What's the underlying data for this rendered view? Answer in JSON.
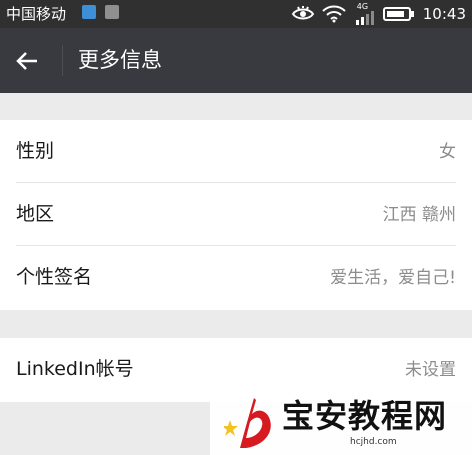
{
  "status_bar": {
    "carrier": "中国移动",
    "network": "4G",
    "time": "10:43"
  },
  "toolbar": {
    "title": "更多信息"
  },
  "profile": {
    "rows": [
      {
        "label": "性别",
        "value": "女"
      },
      {
        "label": "地区",
        "value": "江西 赣州"
      },
      {
        "label": "个性签名",
        "value": "爱生活，爱自己!"
      }
    ],
    "linkedin": {
      "label": "LinkedIn帐号",
      "value": "未设置"
    }
  },
  "watermark": {
    "text": "宝安教程网",
    "url": "hcjhd.com"
  },
  "colors": {
    "status_bar": "#303030",
    "toolbar": "#393a3f",
    "page_background": "#ebebeb",
    "watermark_red": "#d71920",
    "watermark_star": "#f4c21f"
  }
}
